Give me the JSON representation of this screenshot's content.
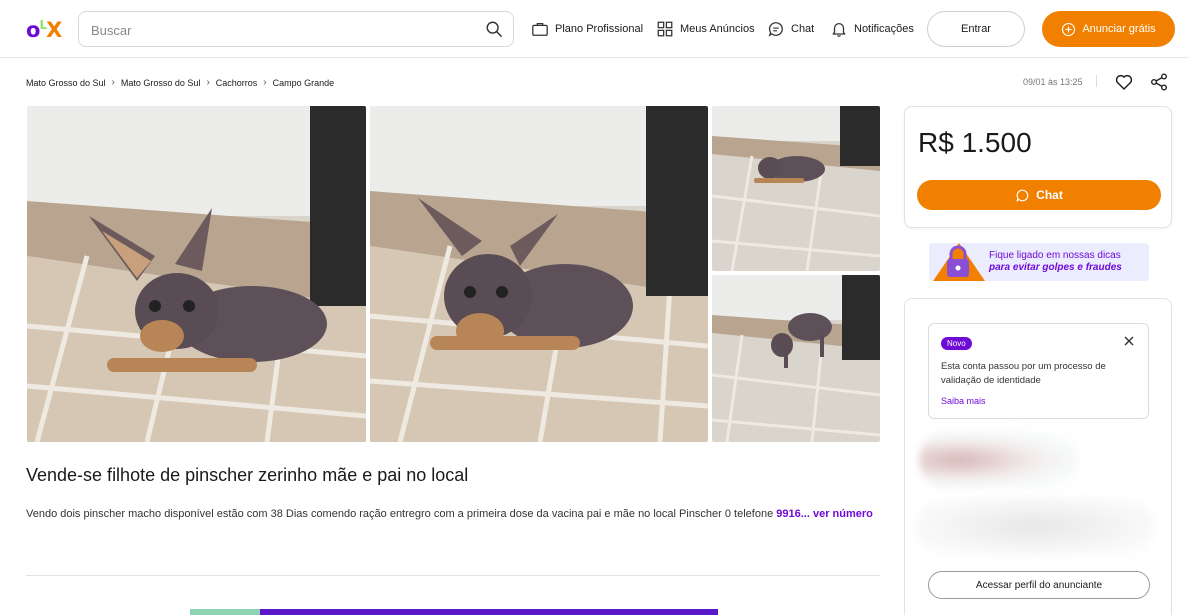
{
  "header": {
    "logo": {
      "o": "o",
      "l": "L",
      "x": "X"
    },
    "search": {
      "placeholder": "Buscar",
      "value": ""
    },
    "nav": [
      {
        "label": "Plano Profissional",
        "icon": "briefcase-icon"
      },
      {
        "label": "Meus Anúncios",
        "icon": "grid-icon"
      },
      {
        "label": "Chat",
        "icon": "chat-icon"
      },
      {
        "label": "Notificações",
        "icon": "bell-icon"
      }
    ],
    "login_label": "Entrar",
    "post_label": "Anunciar grátis"
  },
  "breadcrumb": [
    "Mato Grosso do Sul",
    "Mato Grosso do Sul",
    "Cachorros",
    "Campo Grande"
  ],
  "meta": {
    "date": "09/01 às 13:25"
  },
  "listing": {
    "title": "Vende-se filhote de pinscher zerinho mãe e pai no local",
    "description": "Vendo dois pinscher macho disponível estão com 38 Dias comendo ração entregro com a primeira dose da vacina pai e mãe no local Pinscher 0 telefone ",
    "phone_partial": "9916...",
    "show_number": "ver número"
  },
  "sidebar": {
    "price": "R$ 1.500",
    "chat_label": "Chat",
    "banner_line1": "Fique ligado em nossas dicas",
    "banner_line2": "para evitar golpes e fraudes",
    "notice": {
      "badge": "Novo",
      "text": "Esta conta passou por um processo de validação de identidade",
      "link": "Saiba mais"
    },
    "profile_button": "Acessar perfil do anunciante"
  },
  "colors": {
    "brand_purple": "#6e0ad6",
    "brand_orange": "#f28000"
  }
}
